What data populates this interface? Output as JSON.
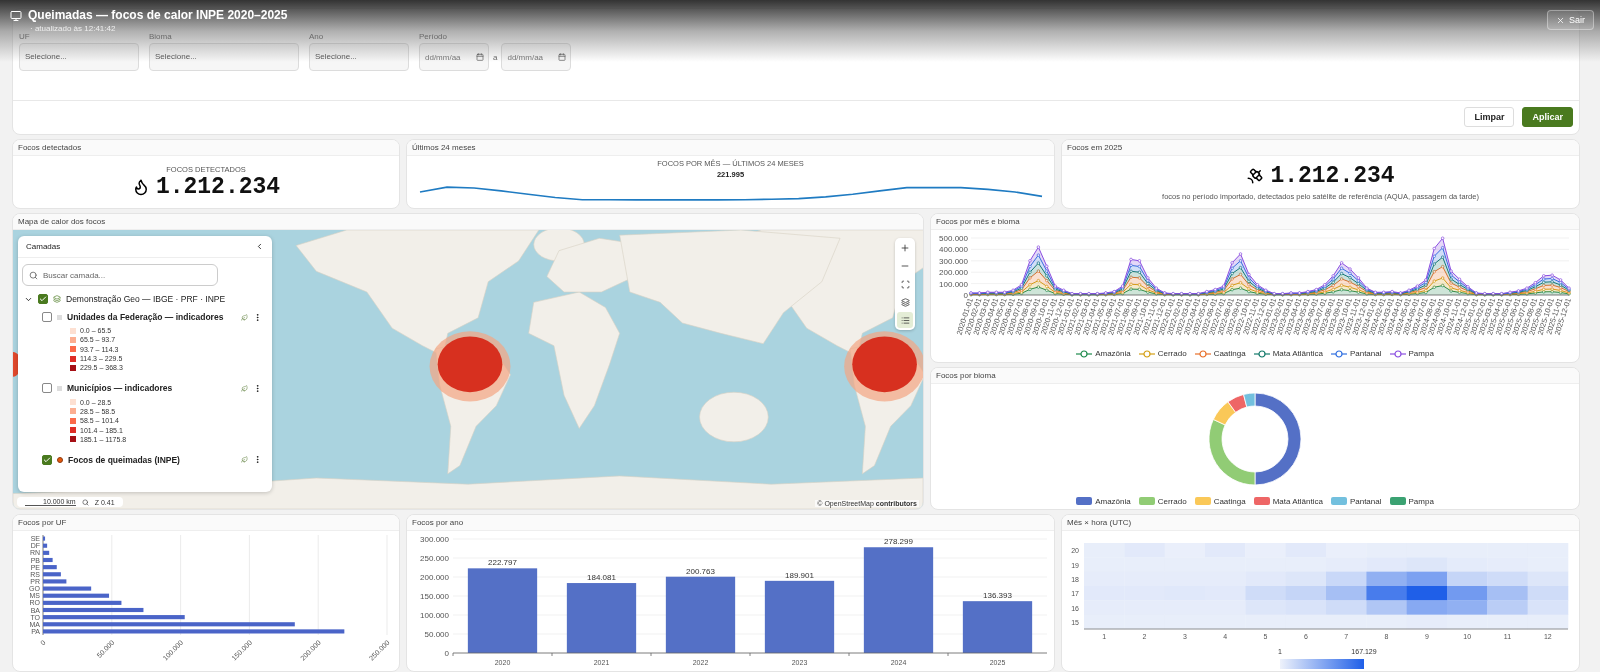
{
  "header": {
    "title": "Queimadas — focos de calor INPE 2020–2025",
    "subtitle": "· atualizado às 12:41:42",
    "exit_button": "Sair"
  },
  "filters": {
    "fields": [
      {
        "kind": "select",
        "label": "UF",
        "placeholder": "Selecione..."
      },
      {
        "kind": "select",
        "label": "Bioma",
        "placeholder": "Selecione..."
      },
      {
        "kind": "select",
        "label": "Ano",
        "placeholder": "Selecione..."
      },
      {
        "kind": "daterange",
        "label": "Período",
        "placeholder": "dd/mm/aa",
        "separator": "a",
        "placeholder_end": "dd/mm/aa"
      }
    ],
    "buttons": [
      {
        "kind": "secondary",
        "label": "Limpar"
      },
      {
        "kind": "primary",
        "label": "Aplicar"
      }
    ]
  },
  "kpis": [
    {
      "kind": "flame",
      "title": "Focos detectados",
      "caption": "FOCOS DETECTADOS",
      "value": "1.212.234"
    },
    {
      "kind": "sparkline",
      "title": "Últimos 24 meses",
      "caption": "FOCOS POR MÊS — ÚLTIMOS 24 MESES",
      "value": "221.995"
    },
    {
      "kind": "satellite",
      "title": "Focos em 2025",
      "value": "1.212.234",
      "note": "focos no período importado, detectados pelo satélite de referência (AQUA, passagem da tarde)"
    }
  ],
  "map": {
    "title": "Mapa de calor dos focos",
    "layers_panel": {
      "title": "Camadas",
      "search_placeholder": "Buscar camada...",
      "tree": [
        {
          "kind": "group",
          "label": "Demonstração Geo — IBGE · PRF · INPE",
          "checked": true,
          "expanded": true,
          "children": [
            {
              "kind": "choropleth",
              "label": "Unidades da Federação — indicadores",
              "checked": false,
              "legend": [
                {
                  "label": "0.0 – 65.5",
                  "color": "#fde0d2"
                },
                {
                  "label": "65.5 – 93.7",
                  "color": "#fcae91"
                },
                {
                  "label": "93.7 – 114.3",
                  "color": "#fb6a4a"
                },
                {
                  "label": "114.3 – 229.5",
                  "color": "#de2d26"
                },
                {
                  "label": "229.5 – 368.3",
                  "color": "#a50f15"
                }
              ]
            },
            {
              "kind": "choropleth",
              "label": "Municípios — indicadores",
              "checked": false,
              "legend": [
                {
                  "label": "0.0 – 28.5",
                  "color": "#fde0d2"
                },
                {
                  "label": "28.5 – 58.5",
                  "color": "#fcae91"
                },
                {
                  "label": "58.5 – 101.4",
                  "color": "#fb6a4a"
                },
                {
                  "label": "101.4 – 185.1",
                  "color": "#de2d26"
                },
                {
                  "label": "185.1 – 1175.8",
                  "color": "#a50f15"
                }
              ]
            },
            {
              "kind": "points",
              "label": "Focos de queimadas (INPE)",
              "checked": true
            }
          ]
        }
      ]
    },
    "controls": [
      {
        "kind": "zoom-in",
        "selected": false
      },
      {
        "kind": "zoom-out",
        "selected": false
      },
      {
        "kind": "fit",
        "selected": false
      },
      {
        "kind": "layers",
        "selected": false
      },
      {
        "kind": "list",
        "selected": true
      }
    ],
    "scale": "10.000 km",
    "zoom": "Z 0.41",
    "attribution": "© OpenStreetMap **contributors**"
  },
  "monthly_chart": {
    "title": "Focos por mês e bioma",
    "chart_data": {
      "type": "area",
      "stacked": true,
      "grid": true,
      "ylim": [
        0,
        500
      ],
      "yticks": [
        {
          "value": 0,
          "label": "0"
        },
        {
          "value": 100,
          "label": "100.000"
        },
        {
          "value": 200,
          "label": "200.000"
        },
        {
          "value": 300,
          "label": "300.000"
        },
        {
          "value": 400,
          "label": "400.000"
        },
        {
          "value": 500,
          "label": "500.000"
        }
      ],
      "categories": [
        "2020-01-01",
        "2020-02-01",
        "2020-03-01",
        "2020-04-01",
        "2020-05-01",
        "2020-06-01",
        "2020-07-01",
        "2020-08-01",
        "2020-09-01",
        "2020-10-01",
        "2020-11-01",
        "2020-12-01",
        "2021-01-01",
        "2021-02-01",
        "2021-03-01",
        "2021-04-01",
        "2021-05-01",
        "2021-06-01",
        "2021-07-01",
        "2021-08-01",
        "2021-09-01",
        "2021-10-01",
        "2021-11-01",
        "2021-12-01",
        "2022-01-01",
        "2022-02-01",
        "2022-03-01",
        "2022-04-01",
        "2022-05-01",
        "2022-06-01",
        "2022-07-01",
        "2022-08-01",
        "2022-09-01",
        "2022-10-01",
        "2022-11-01",
        "2022-12-01",
        "2023-01-01",
        "2023-02-01",
        "2023-03-01",
        "2023-04-01",
        "2023-05-01",
        "2023-06-01",
        "2023-07-01",
        "2023-08-01",
        "2023-09-01",
        "2023-10-01",
        "2023-11-01",
        "2023-12-01",
        "2024-01-01",
        "2024-02-01",
        "2024-03-01",
        "2024-04-01",
        "2024-05-01",
        "2024-06-01",
        "2024-07-01",
        "2024-08-01",
        "2024-09-01",
        "2024-10-01",
        "2024-11-01",
        "2024-12-01",
        "2025-01-01",
        "2025-02-01",
        "2025-03-01",
        "2025-04-01",
        "2025-05-01",
        "2025-06-01",
        "2025-07-01",
        "2025-08-01",
        "2025-09-01",
        "2025-10-01",
        "2025-11-01",
        "2025-12-01"
      ],
      "series": [
        {
          "name": "Amazônia",
          "color": "#1e8a4c",
          "values": [
            3,
            3,
            4,
            4,
            4,
            7,
            15,
            50,
            70,
            42,
            13,
            7,
            2,
            2,
            2,
            2,
            3,
            5,
            13,
            52,
            50,
            25,
            10,
            3,
            2,
            2,
            2,
            2,
            5,
            8,
            13,
            47,
            60,
            30,
            15,
            7,
            2,
            2,
            3,
            3,
            5,
            8,
            15,
            28,
            47,
            38,
            25,
            10,
            4,
            4,
            5,
            3,
            7,
            13,
            22,
            68,
            83,
            35,
            23,
            12,
            3,
            2,
            2,
            2,
            4,
            6,
            10,
            18,
            28,
            29,
            22,
            10
          ]
        },
        {
          "name": "Cerrado",
          "color": "#d4a017",
          "values": [
            2,
            2,
            3,
            3,
            3,
            6,
            12,
            40,
            56,
            34,
            10,
            6,
            2,
            2,
            2,
            2,
            2,
            4,
            10,
            42,
            40,
            20,
            8,
            2,
            2,
            2,
            2,
            2,
            4,
            6,
            10,
            38,
            48,
            24,
            12,
            6,
            2,
            2,
            2,
            2,
            4,
            6,
            12,
            22,
            38,
            30,
            20,
            8,
            3,
            3,
            4,
            2,
            6,
            10,
            18,
            54,
            66,
            28,
            18,
            10,
            2,
            2,
            2,
            2,
            3,
            5,
            8,
            14,
            22,
            23,
            18,
            8
          ]
        },
        {
          "name": "Caatinga",
          "color": "#e8702a",
          "values": [
            4,
            4,
            5,
            5,
            5,
            8,
            18,
            60,
            84,
            50,
            16,
            8,
            2,
            2,
            2,
            2,
            4,
            6,
            16,
            62,
            60,
            30,
            12,
            4,
            2,
            2,
            2,
            2,
            6,
            10,
            16,
            56,
            72,
            36,
            18,
            8,
            2,
            2,
            4,
            4,
            6,
            10,
            18,
            34,
            56,
            46,
            30,
            12,
            5,
            5,
            6,
            4,
            8,
            16,
            26,
            82,
            100,
            42,
            28,
            14,
            4,
            2,
            2,
            2,
            5,
            7,
            12,
            22,
            34,
            35,
            26,
            12
          ]
        },
        {
          "name": "Mata Atlântica",
          "color": "#137a6a",
          "values": [
            3,
            3,
            4,
            4,
            4,
            7,
            15,
            50,
            70,
            42,
            13,
            7,
            2,
            2,
            2,
            2,
            3,
            5,
            13,
            52,
            50,
            25,
            10,
            3,
            2,
            2,
            2,
            2,
            5,
            8,
            13,
            47,
            60,
            30,
            15,
            7,
            2,
            2,
            3,
            3,
            5,
            8,
            15,
            28,
            47,
            38,
            25,
            10,
            4,
            4,
            5,
            3,
            7,
            13,
            22,
            68,
            83,
            35,
            23,
            12,
            3,
            2,
            2,
            2,
            4,
            6,
            10,
            18,
            28,
            29,
            22,
            10
          ]
        },
        {
          "name": "Pantanal",
          "color": "#2f6fe0",
          "values": [
            3,
            3,
            4,
            4,
            4,
            7,
            15,
            50,
            70,
            42,
            13,
            7,
            2,
            2,
            2,
            2,
            3,
            5,
            13,
            52,
            50,
            25,
            10,
            3,
            2,
            2,
            2,
            2,
            5,
            8,
            13,
            47,
            60,
            30,
            15,
            7,
            2,
            2,
            3,
            3,
            5,
            8,
            15,
            28,
            47,
            38,
            25,
            10,
            4,
            4,
            5,
            3,
            7,
            13,
            22,
            68,
            83,
            35,
            23,
            12,
            3,
            2,
            2,
            2,
            4,
            6,
            10,
            18,
            28,
            29,
            22,
            10
          ]
        },
        {
          "name": "Pampa",
          "color": "#8a4ee0",
          "values": [
            3,
            3,
            4,
            4,
            4,
            7,
            15,
            50,
            70,
            42,
            13,
            7,
            2,
            2,
            2,
            2,
            3,
            5,
            13,
            52,
            50,
            25,
            10,
            3,
            2,
            2,
            2,
            2,
            5,
            8,
            13,
            47,
            60,
            30,
            15,
            7,
            2,
            2,
            3,
            3,
            5,
            8,
            15,
            28,
            47,
            38,
            25,
            10,
            4,
            4,
            5,
            3,
            7,
            13,
            22,
            68,
            83,
            35,
            23,
            12,
            3,
            2,
            2,
            2,
            4,
            6,
            10,
            18,
            28,
            29,
            22,
            10
          ]
        }
      ]
    }
  },
  "biome_chart": {
    "title": "Focos por bioma",
    "legend": [
      {
        "label": "Amazônia",
        "color": "#5470c6"
      },
      {
        "label": "Cerrado",
        "color": "#91cc75"
      },
      {
        "label": "Caatinga",
        "color": "#fac858"
      },
      {
        "label": "Mata Atlântica",
        "color": "#ee6666"
      },
      {
        "label": "Pantanal",
        "color": "#73c0de"
      },
      {
        "label": "Pampa",
        "color": "#3ba272"
      }
    ]
  },
  "uf_chart": {
    "title": "Focos por UF",
    "chart_data": {
      "type": "bar",
      "orientation": "horizontal",
      "grid": true,
      "xlim": [
        0,
        250
      ],
      "xticks": [
        {
          "value": 0,
          "label": "0"
        },
        {
          "value": 50,
          "label": "50.000"
        },
        {
          "value": 100,
          "label": "100.000"
        },
        {
          "value": 150,
          "label": "150.000"
        },
        {
          "value": 200,
          "label": "200.000"
        },
        {
          "value": 250,
          "label": "250.000"
        }
      ],
      "categories": [
        "SE",
        "DF",
        "RN",
        "PB",
        "PE",
        "RS",
        "PR",
        "GO",
        "MS",
        "RO",
        "BA",
        "TO",
        "MA",
        "PA"
      ],
      "values": [
        1.5,
        3,
        4.5,
        7,
        10,
        13,
        17,
        35,
        48,
        57,
        73,
        103,
        183,
        219
      ]
    }
  },
  "year_chart": {
    "title": "Focos por ano",
    "chart_data": {
      "type": "bar",
      "grid": true,
      "ylim": [
        0,
        300
      ],
      "yticks": [
        {
          "value": 0,
          "label": "0"
        },
        {
          "value": 50,
          "label": "50.000"
        },
        {
          "value": 100,
          "label": "100.000"
        },
        {
          "value": 150,
          "label": "150.000"
        },
        {
          "value": 200,
          "label": "200.000"
        },
        {
          "value": 250,
          "label": "250.000"
        },
        {
          "value": 300,
          "label": "300.000"
        }
      ],
      "categories": [
        "2020",
        "2021",
        "2022",
        "2023",
        "2024",
        "2025"
      ],
      "values": [
        222.797,
        184.081,
        200.763,
        189.901,
        278.299,
        136.393
      ],
      "value_labels": [
        "222.797",
        "184.081",
        "200.763",
        "189.901",
        "278.299",
        "136.393"
      ]
    }
  },
  "heatmap": {
    "title": "Mês × hora (UTC)",
    "x_labels": [
      "1",
      "2",
      "3",
      "4",
      "5",
      "6",
      "7",
      "8",
      "9",
      "10",
      "11",
      "12"
    ],
    "y_labels": [
      "20",
      "19",
      "18",
      "17",
      "16",
      "15"
    ],
    "scale_min": "1",
    "scale_max": "167.129"
  }
}
